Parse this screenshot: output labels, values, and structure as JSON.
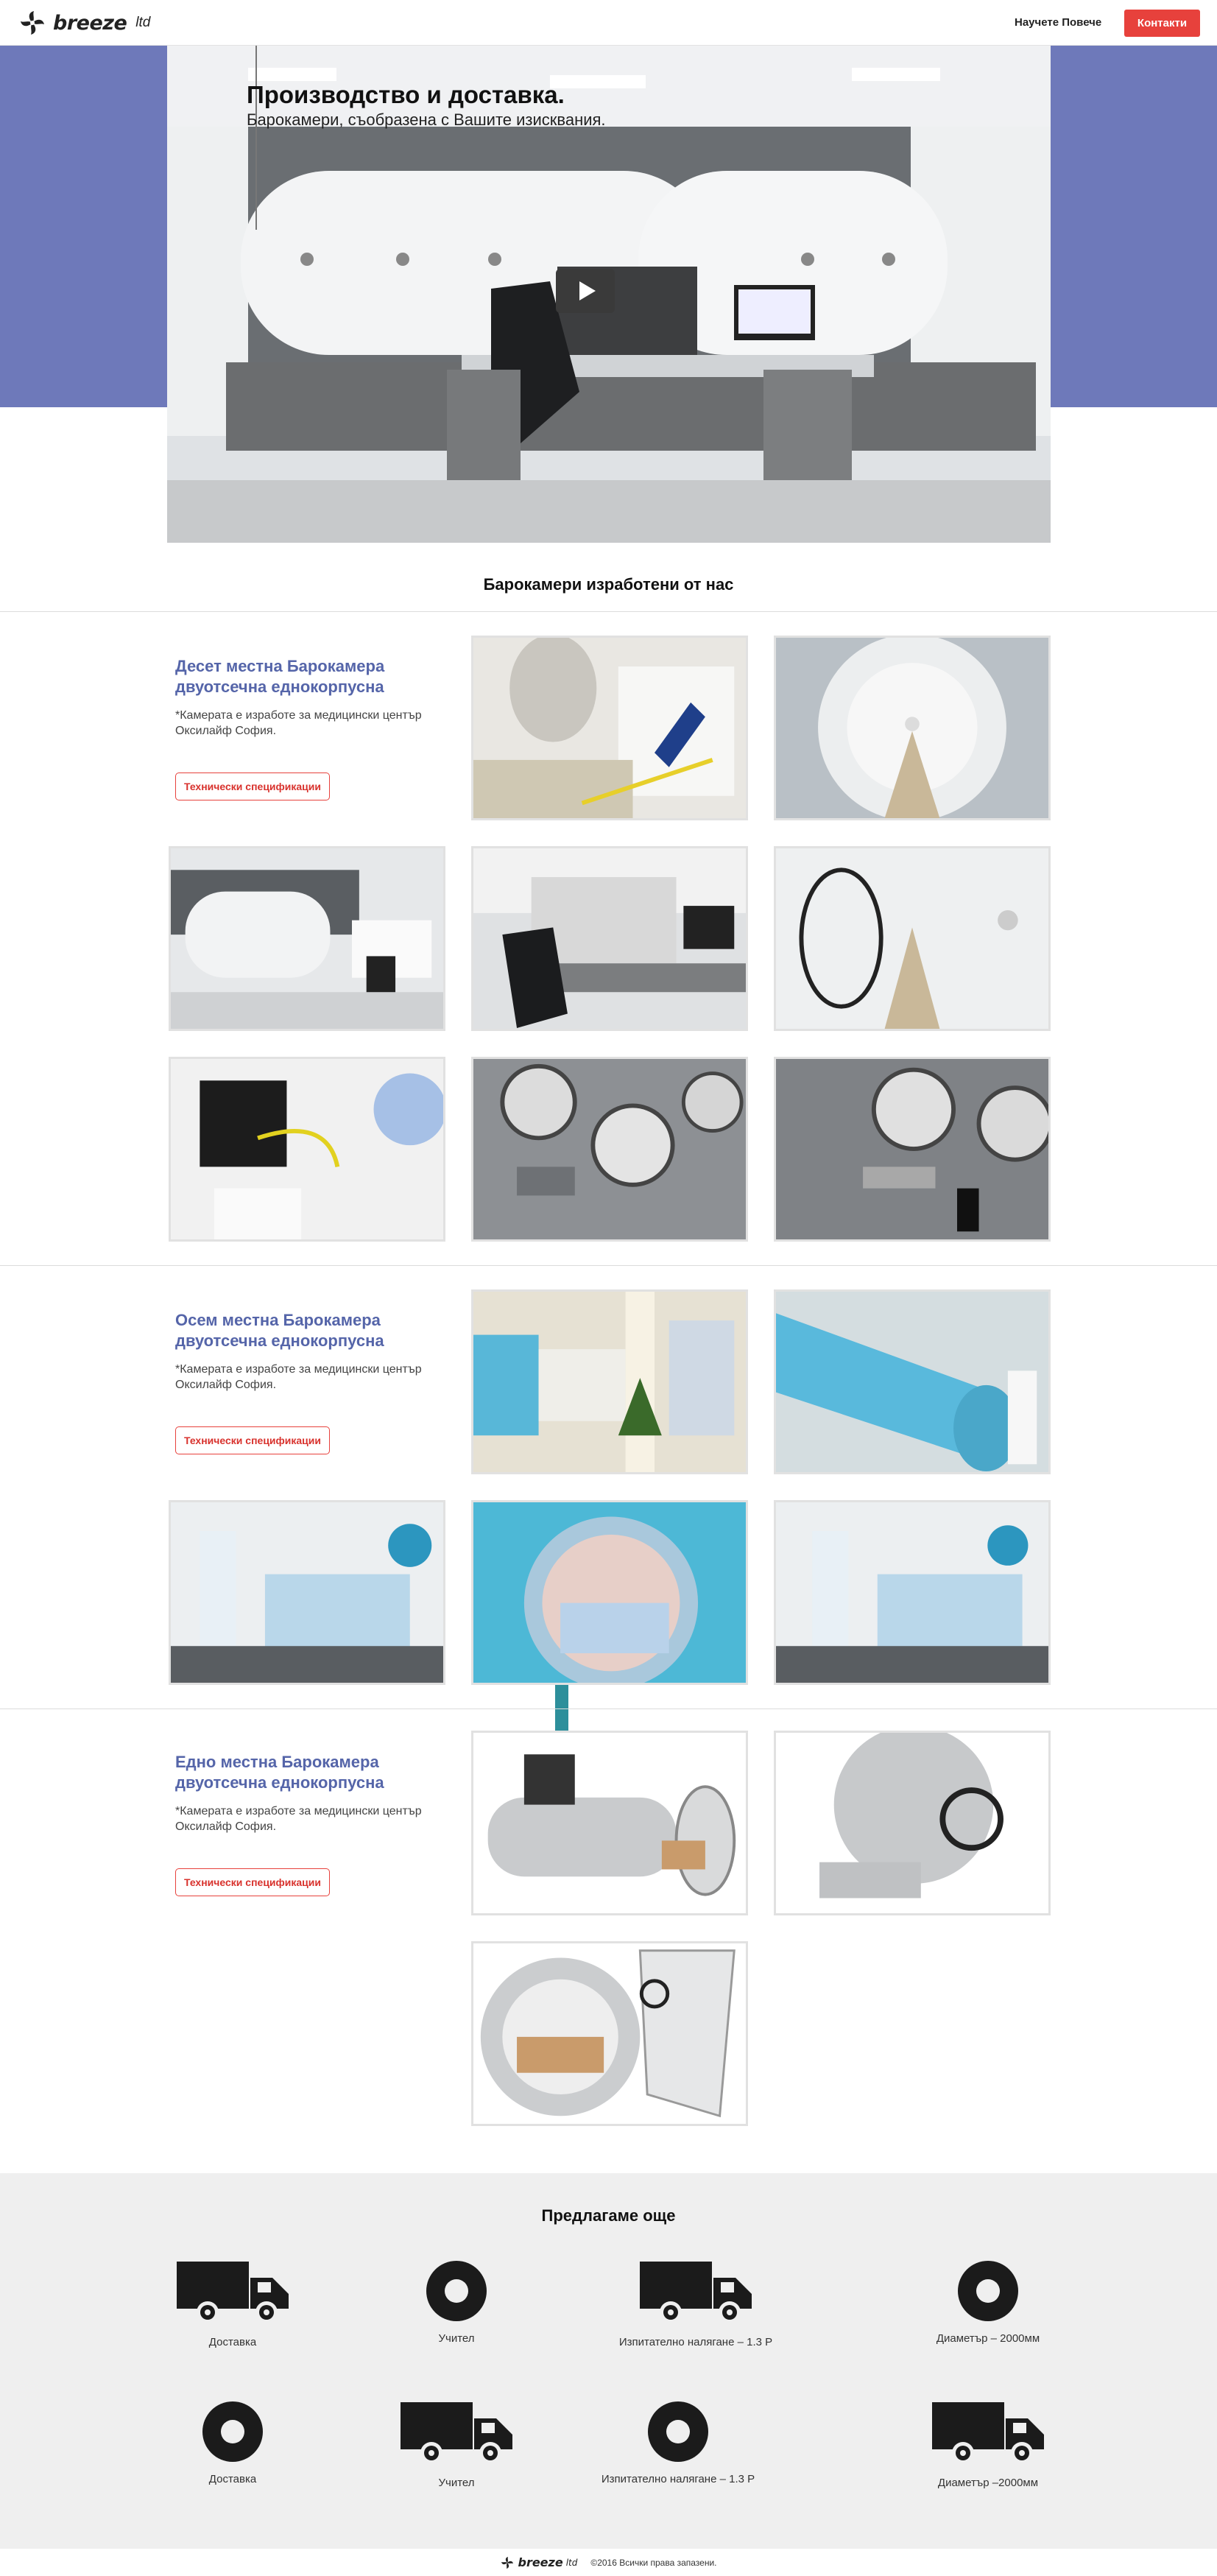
{
  "header": {
    "logo_text": "breeze",
    "logo_suffix": "ltd",
    "nav_more": "Научете Повече",
    "nav_contacts": "Контакти"
  },
  "hero": {
    "title": "Производство и доставка.",
    "subtitle": "Барокамери, съобразена с Вашите изисквания."
  },
  "main": {
    "heading": "Барокамери изработени от нас",
    "products": [
      {
        "title": "Десет местна  Барокамера двуотсечна еднокорпусна",
        "note": "*Камерата е изработе за медицински център Оксилайф София.",
        "button": "Технически спецификации"
      },
      {
        "title": "Осем местна  Барокамера двуотсечна еднокорпусна",
        "note": "*Камерата е изработе за медицински център Оксилайф София.",
        "button": "Технически спецификации"
      },
      {
        "title": "Едно местна  Барокамера двуотсечна еднокорпусна",
        "note": "*Камерата е изработе за медицински център Оксилайф София.",
        "button": "Технически спецификации"
      }
    ]
  },
  "offer": {
    "title": "Предлагаме още",
    "items": [
      {
        "label": "Доставка",
        "icon": "truck-icon"
      },
      {
        "label": "Учител",
        "icon": "ring-icon"
      },
      {
        "label": "Изпитателно налягане – 1.3 P",
        "icon": "truck-icon"
      },
      {
        "label": "Диаметър –  2000мм",
        "icon": "ring-icon"
      },
      {
        "label": "Доставка",
        "icon": "ring-icon"
      },
      {
        "label": "Учител",
        "icon": "truck-icon"
      },
      {
        "label": "Изпитателно налягане – 1.3 P",
        "icon": "ring-icon"
      },
      {
        "label": "Диаметър –2000мм",
        "icon": "truck-icon"
      }
    ]
  },
  "footer": {
    "logo_text": "breeze",
    "logo_suffix": "ltd",
    "copyright": "©2016 Всички права запазени."
  },
  "colors": {
    "accent_red": "#e7413c",
    "hero_band": "#6e79ba",
    "title_blue": "#5565a9"
  }
}
